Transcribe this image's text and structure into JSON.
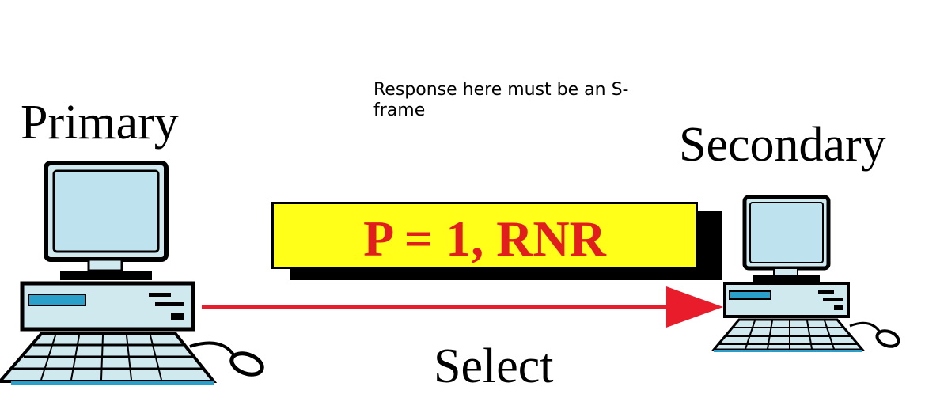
{
  "note": {
    "text": "Response here must be an S-frame"
  },
  "stations": {
    "primary_label": "Primary",
    "secondary_label": "Secondary"
  },
  "frame": {
    "text": "P = 1, RNR",
    "box_color": "#ffff19",
    "text_color": "#e11e1e"
  },
  "arrow": {
    "label": "Select",
    "color": "#e81c2a"
  },
  "computer_colors": {
    "body": "#cfe9ef",
    "outline": "#000000",
    "screen": "#bfe3ee",
    "drive": "#2a9fc9"
  }
}
